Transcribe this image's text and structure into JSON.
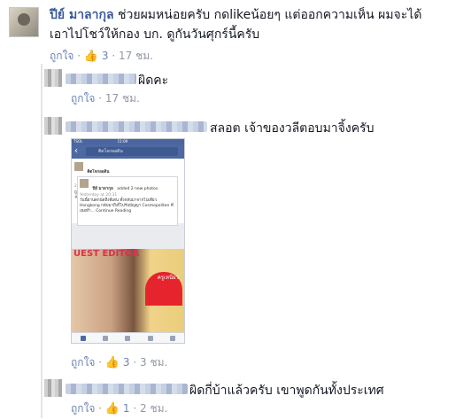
{
  "comments": [
    {
      "author": "ปีย์ มาลากุล",
      "text_line1": "ช่วยผมหน่อยครับ กดlikeน้อยๆ แต่ออกความเห็น ผมจะได้",
      "text_line2": "เอาไปโชว์ให้กอง บก. ดูกันวันศุกร์นี้ครับ",
      "like_label": "ถูกใจ",
      "like_count": "3",
      "time": "17 ชม."
    }
  ],
  "replies": [
    {
      "text": "ผิดคะ",
      "like_label": "ถูกใจ",
      "like_count": "",
      "time": "17 ชม."
    },
    {
      "text": "สลอต เจ้าของวลีตอบมาจิ้งครับ",
      "like_label": "ถูกใจ",
      "like_count": "3",
      "time": "3 ชม.",
      "attachment": {
        "status_left": "TSOL",
        "status_time": "11:09",
        "search_text": "ติดโจกออดิน",
        "page_name": "ติดโจกออดิน",
        "post_time": "20 mins",
        "post_text_1": "ถูกนั่งครับ ถูกิ้นทั้นลา",
        "post_text_2": "#รู้จักไหมใช่ #TeamBoyPakorn",
        "shared_author": "ปีย์ มาลากุล",
        "shared_action": "added 2 new photos.",
        "shared_time": "Yesterday at 20:31",
        "shared_text": "วันนี้ผ่านตกนัดถึงพี่เด่น ทั้งกลับมาจากไปเที่ยว Hongkong กลับมาถึงก็ไปรับปัญญา Cosmopolitan ที่เธอทำ... Continue Reading",
        "mag_title": "UEST EDITOR",
        "mag_badge": "ครูเหนียว",
        "tabs": [
          "News Feed",
          "Requests",
          "Messenger",
          "Notifications",
          "More"
        ]
      }
    },
    {
      "text": "ผิดกี่บ้าแล้วครับ เขาพูดกันทั้งประเทศ",
      "like_label": "ถูกใจ",
      "like_count": "1",
      "time": "2 ชม."
    }
  ]
}
